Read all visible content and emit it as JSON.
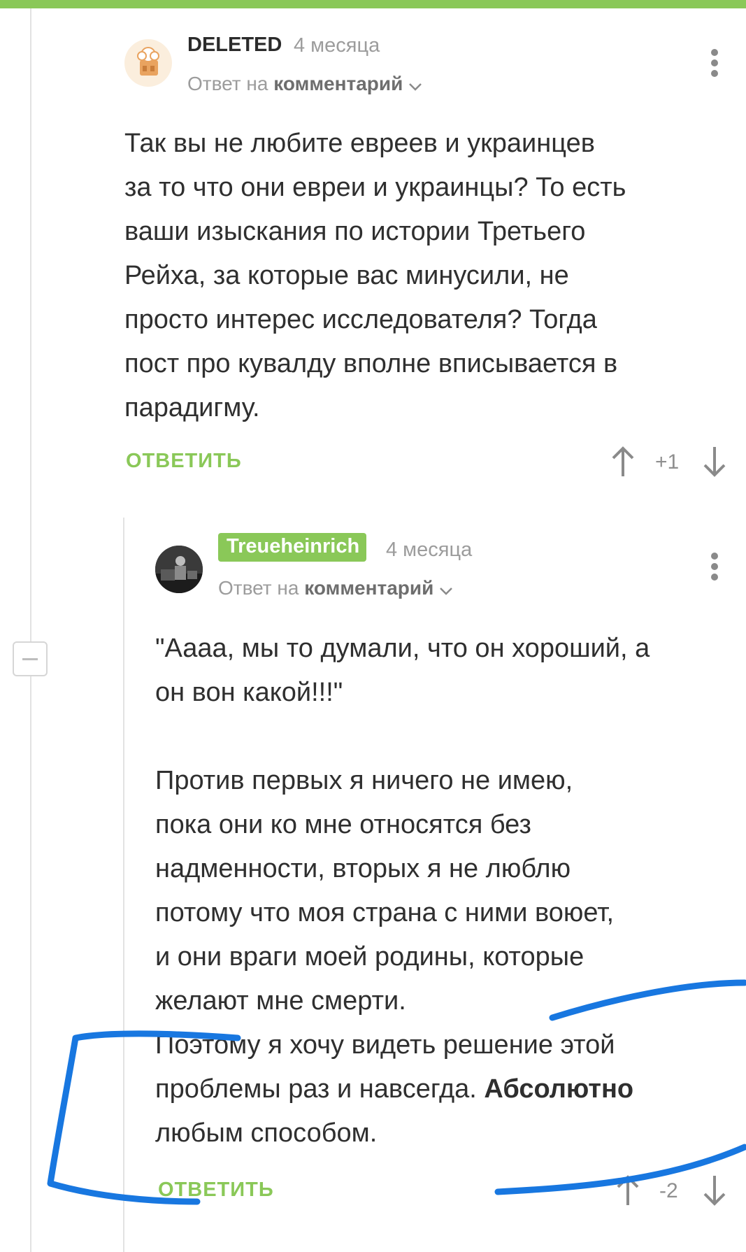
{
  "comments": [
    {
      "username": "DELETED",
      "time": "4 месяца",
      "reply_prefix": "Ответ на",
      "reply_target": "комментарий",
      "text": "Так вы не любите евреев и украинцев\nза то что они евреи и украинцы? То есть\nваши изыскания по истории Третьего\nРейха, за которые вас минусили, не\nпросто интерес исследователя? Тогда\nпост про кувалду вполне вписывается в\nпарадигму.",
      "reply_label": "ОТВЕТИТЬ",
      "rating": "+1"
    },
    {
      "username": "Treueheinrich",
      "time": "4 месяца",
      "reply_prefix": "Ответ на",
      "reply_target": "комментарий",
      "text_part1": "\"Аааа, мы то думали, что он хороший, а\nон вон какой!!!\"\n\nПротив первых я ничего не имею,\nпока они ко мне относятся без\nнадменности, вторых я не люблю\nпотому что моя страна с ними воюет,\nи они враги моей родины, которые\nжелают мне смерти.\nПоэтому я хочу видеть решение этой\nпроблемы раз и навсегда. ",
      "text_bold": "Абсолютно",
      "text_part2": "\nлюбым способом.",
      "reply_label": "ОТВЕТИТЬ",
      "rating": "-2"
    }
  ],
  "colors": {
    "accent": "#8ac858",
    "annotation": "#1877e0"
  },
  "icons": [
    "more-vertical-icon",
    "chevron-down-icon",
    "arrow-up-icon",
    "arrow-down-icon",
    "collapse-minus-icon"
  ]
}
